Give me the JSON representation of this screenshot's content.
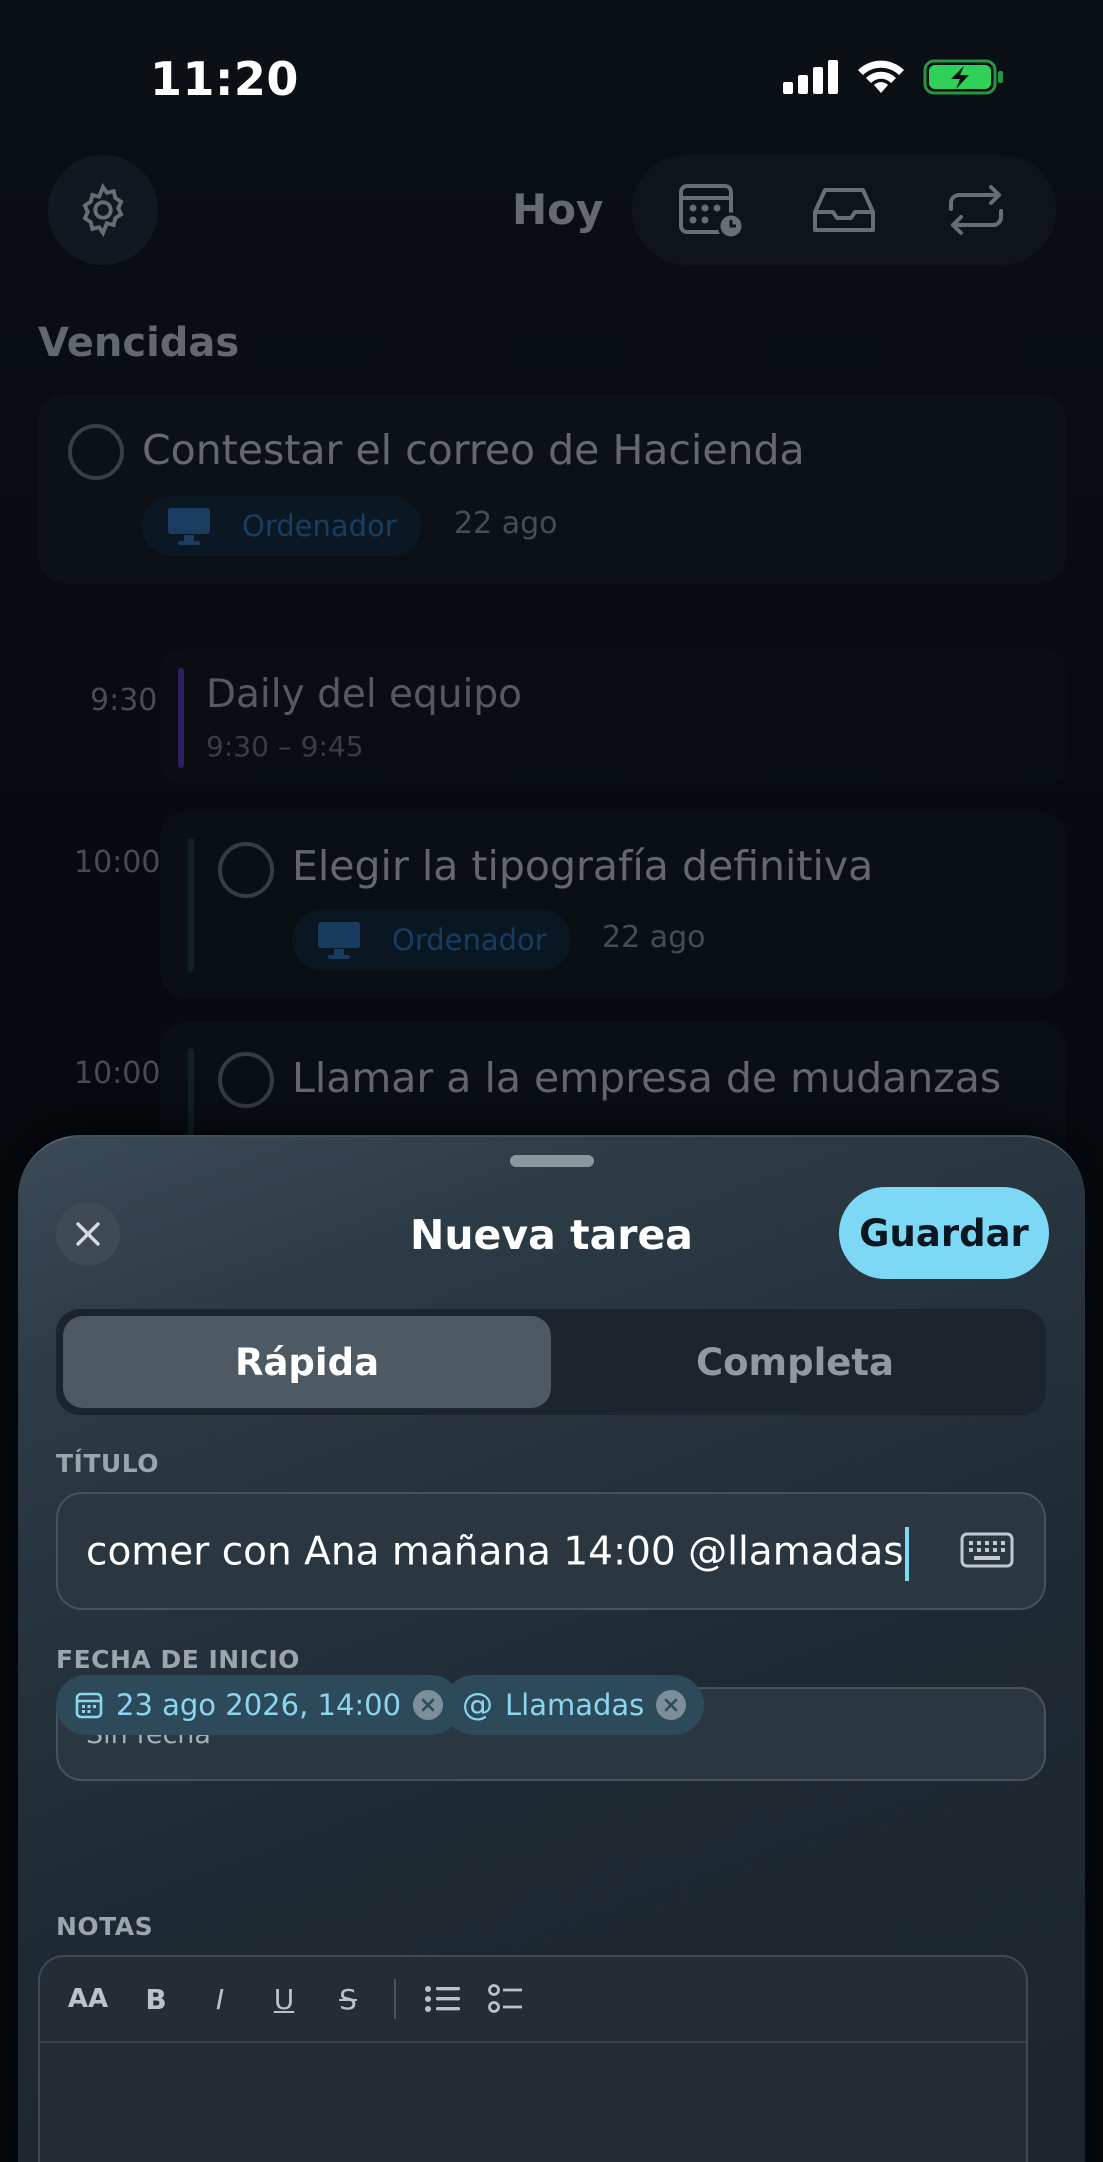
{
  "status": {
    "time": "11:20"
  },
  "header": {
    "title": "Hoy"
  },
  "overdue": {
    "section_title": "Vencidas",
    "tasks": [
      {
        "title": "Contestar el correo de Hacienda",
        "context": "Ordenador",
        "date": "22 ago"
      }
    ]
  },
  "timeline": {
    "event": {
      "hour": "9:30",
      "title": "Daily del equipo",
      "range": "9:30 – 9:45"
    },
    "tasks": [
      {
        "hour": "10:00",
        "title": "Elegir la tipografía definitiva",
        "context": "Ordenador",
        "date": "22 ago"
      },
      {
        "hour": "10:00",
        "title": "Llamar a la empresa de mudanzas"
      }
    ]
  },
  "sheet": {
    "title": "Nueva tarea",
    "save_label": "Guardar",
    "segments": {
      "quick": "Rápida",
      "full": "Completa",
      "selected": "quick"
    },
    "title_label": "TÍTULO",
    "title_value": "comer con Ana mañana 14:00 @llamadas",
    "start_label": "FECHA DE INICIO",
    "start_value": "Sin fecha",
    "chips": {
      "date": "23 ago 2026, 14:00",
      "context": "Llamadas"
    },
    "notes_label": "NOTAS",
    "toolbar": {
      "size": "AA",
      "bold": "B",
      "italic": "I",
      "underline": "U",
      "strike": "S"
    }
  },
  "colors": {
    "accent": "#7dd8f5",
    "event_bar": "#5a37b5",
    "context_chip": "#2b74b8"
  }
}
